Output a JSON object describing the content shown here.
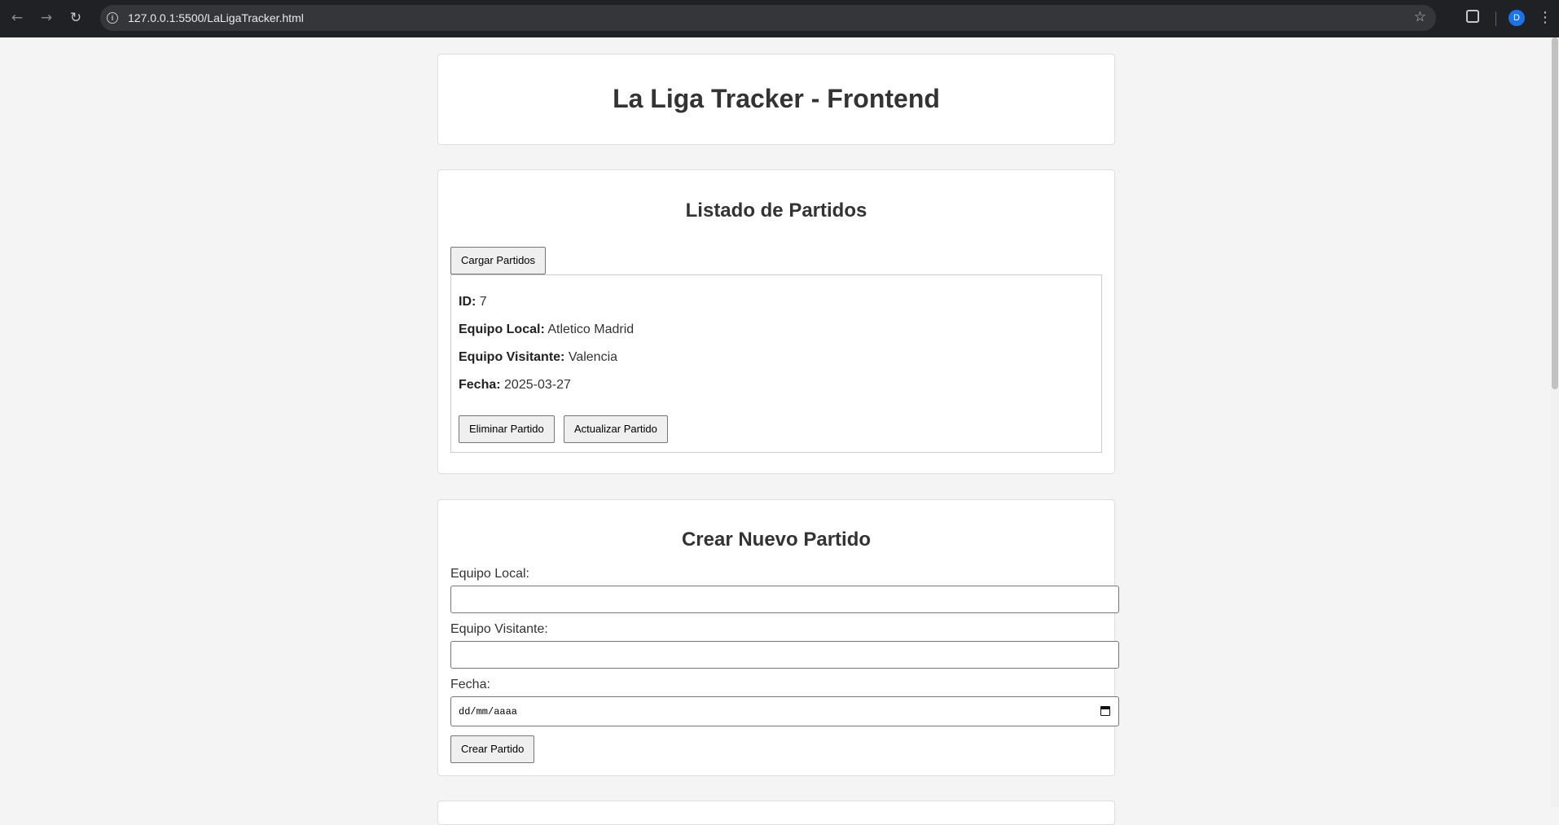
{
  "browser": {
    "url": "127.0.0.1:5500/LaLigaTracker.html",
    "profile_initial": "D",
    "icons": [
      "back-icon",
      "forward-icon",
      "reload-icon",
      "site-info-icon",
      "bookmark-star-icon",
      "extensions-icon",
      "avatar",
      "menu-icon"
    ]
  },
  "header": {
    "title": "La Liga Tracker - Frontend"
  },
  "listado": {
    "title": "Listado de Partidos",
    "load_button": "Cargar Partidos",
    "match": {
      "id_label": "ID:",
      "id_value": "7",
      "local_label": "Equipo Local:",
      "local_value": "Atletico Madrid",
      "visitante_label": "Equipo Visitante:",
      "visitante_value": "Valencia",
      "fecha_label": "Fecha:",
      "fecha_value": "2025-03-27",
      "delete_button": "Eliminar Partido",
      "update_button": "Actualizar Partido"
    }
  },
  "crear": {
    "title": "Crear Nuevo Partido",
    "local_label": "Equipo Local:",
    "local_value": "",
    "visitante_label": "Equipo Visitante:",
    "visitante_value": "",
    "fecha_label": "Fecha:",
    "fecha_placeholder": "dd/mm/aaaa",
    "submit_button": "Crear Partido"
  },
  "colors": {
    "page_bg": "#f4f4f4",
    "card_bg": "#ffffff",
    "chrome_bg": "#202124",
    "avatar_bg": "#1a73e8"
  }
}
